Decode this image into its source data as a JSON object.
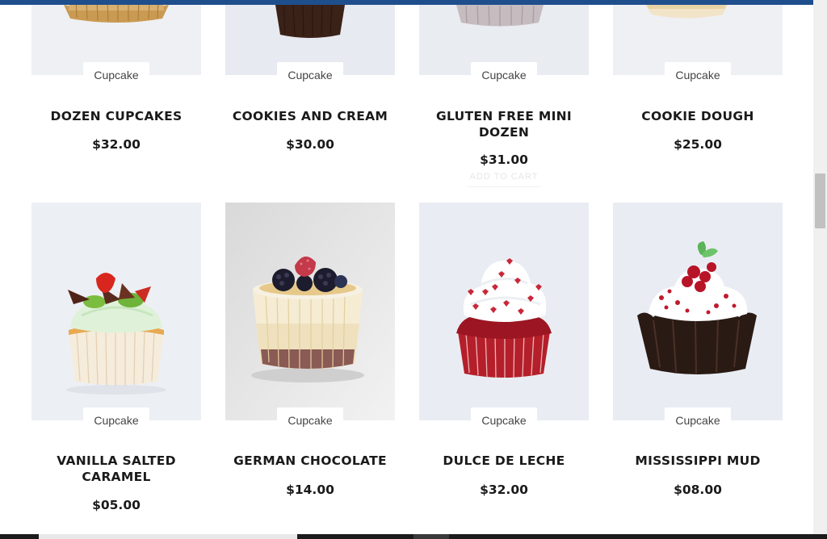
{
  "badge_label": "Cupcake",
  "products_row1": [
    {
      "title": "DOZEN CUPCAKES",
      "price": "$32.00"
    },
    {
      "title": "COOKIES AND CREAM",
      "price": "$30.00"
    },
    {
      "title": "GLUTEN FREE MINI DOZEN",
      "price": "$31.00"
    },
    {
      "title": "COOKIE DOUGH",
      "price": "$25.00"
    }
  ],
  "products_row2": [
    {
      "title": "VANILLA SALTED CARAMEL",
      "price": "$05.00"
    },
    {
      "title": "GERMAN CHOCOLATE",
      "price": "$14.00"
    },
    {
      "title": "DULCE DE LECHE",
      "price": "$32.00"
    },
    {
      "title": "MISSISSIPPI MUD",
      "price": "$08.00"
    }
  ],
  "hover_button_label": "ADD TO CART",
  "colors": {
    "accent": "#1f4e8c",
    "image_bg": "#ebeef3",
    "text": "#1a1a1a"
  }
}
